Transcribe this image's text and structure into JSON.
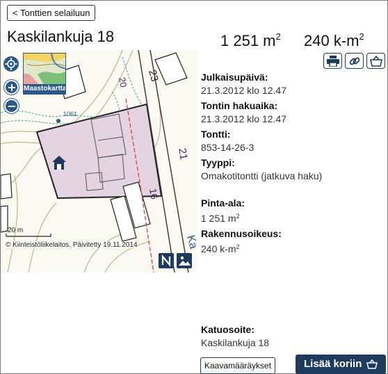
{
  "header": {
    "back_label": "< Tonttien selailuun",
    "title": "Kaskilankuja 18",
    "area_value": "1 251 m",
    "area_unit_sup": "2",
    "build_value": "240 k-m",
    "build_unit_sup": "2"
  },
  "map": {
    "layer_label": "Maastokartta",
    "copyright": "© Kiinteistöliikelaitos. Päivitetty 19.11.2014",
    "scale_label": "20 m",
    "labels": [
      "23",
      "20",
      "21",
      "16",
      "1061",
      "Ka"
    ]
  },
  "tools": {
    "print": "print-icon",
    "link": "link-icon",
    "basket": "basket-icon"
  },
  "info": {
    "published_label": "Julkaisupäivä:",
    "published_value": "21.3.2012 klo 12.47",
    "apply_label": "Tontin hakuaika:",
    "apply_value": "21.3.2012 klo 12.47",
    "plot_label": "Tontti:",
    "plot_value": "853-14-26-3",
    "type_label": "Tyyppi:",
    "type_value": "Omakotitontti (jatkuva haku)",
    "area_label": "Pinta-ala:",
    "area_value": "1 251 m",
    "area_sup": "2",
    "rights_label": "Rakennusoikeus:",
    "rights_value": "240 k-m",
    "rights_sup": "2"
  },
  "address": {
    "label": "Katuosoite:",
    "value": "Kaskilankuja 18"
  },
  "actions": {
    "regs_label": "Kaavamääräykset",
    "cart_label": "Lisää koriin"
  },
  "colors": {
    "navy": "#1e3a5c",
    "plot_fill": "#e4d3e0",
    "contour": "#b8a86e",
    "water": "#5fb0a8",
    "boundary_red": "#d94a4a"
  }
}
